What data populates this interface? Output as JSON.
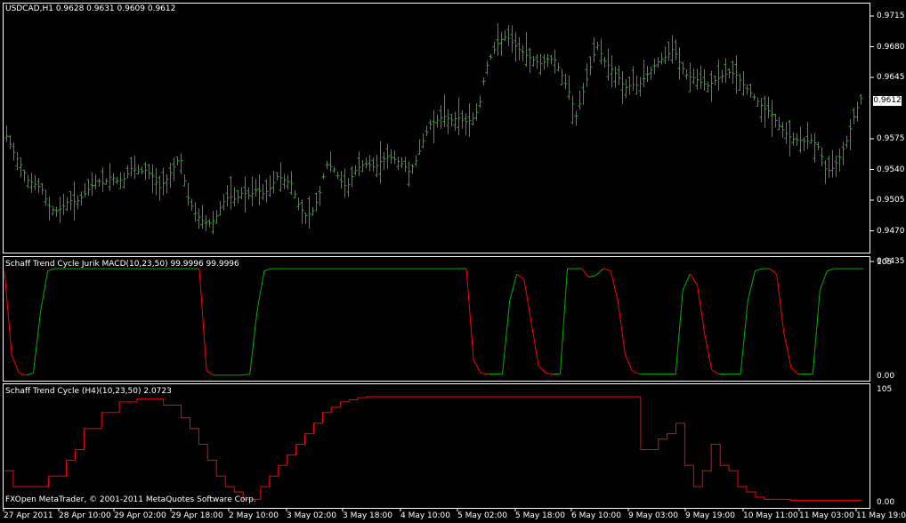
{
  "main_header": "USDCAD,H1  0.9628 0.9631 0.9609 0.9612",
  "current_price": "0.9612",
  "footer_text": "FXOpen MetaTrader, © 2001-2011 MetaQuotes Software Corp.",
  "colors": {
    "background": "#000000",
    "frame": "#ffffff",
    "bars": "#00c000",
    "up": "#00b000",
    "down": "#ff0000"
  },
  "chart_data": [
    {
      "type": "ohlc",
      "title": "USDCAD,H1",
      "ylim": [
        0.942,
        0.973
      ],
      "y_ticks": [
        "0.9715",
        "0.9680",
        "0.9645",
        "0.9612",
        "0.9575",
        "0.9540",
        "0.9505",
        "0.9470",
        "0.9435"
      ],
      "x_ticks": [
        "27 Apr 2011",
        "28 Apr 10:00",
        "29 Apr 02:00",
        "29 Apr 18:00",
        "2 May 10:00",
        "3 May 02:00",
        "3 May 18:00",
        "4 May 10:00",
        "5 May 02:00",
        "5 May 18:00",
        "6 May 10:00",
        "9 May 03:00",
        "9 May 19:00",
        "10 May 11:00",
        "11 May 03:00",
        "11 May 19:00"
      ],
      "close_path": [
        0.9565,
        0.9545,
        0.953,
        0.951,
        0.9505,
        0.95,
        0.9478,
        0.947,
        0.9475,
        0.9485,
        0.9482,
        0.949,
        0.95,
        0.951,
        0.9505,
        0.9515,
        0.9508,
        0.9512,
        0.9525,
        0.952,
        0.9522,
        0.9515,
        0.95,
        0.951,
        0.9525,
        0.954,
        0.949,
        0.947,
        0.946,
        0.9455,
        0.946,
        0.948,
        0.949,
        0.9485,
        0.9495,
        0.949,
        0.9498,
        0.9492,
        0.95,
        0.9515,
        0.951,
        0.9505,
        0.948,
        0.9465,
        0.947,
        0.949,
        0.953,
        0.9525,
        0.951,
        0.95,
        0.952,
        0.9528,
        0.953,
        0.9525,
        0.9535,
        0.954,
        0.9535,
        0.953,
        0.952,
        0.9535,
        0.956,
        0.958,
        0.9585,
        0.959,
        0.9585,
        0.9588,
        0.9583,
        0.9585,
        0.96,
        0.965,
        0.967,
        0.9685,
        0.969,
        0.968,
        0.9672,
        0.9665,
        0.966,
        0.9655,
        0.9662,
        0.966,
        0.964,
        0.962,
        0.959,
        0.962,
        0.965,
        0.968,
        0.966,
        0.965,
        0.964,
        0.9625,
        0.963,
        0.9628,
        0.964,
        0.965,
        0.966,
        0.9665,
        0.9675,
        0.9655,
        0.964,
        0.9638,
        0.9632,
        0.9628,
        0.9635,
        0.964,
        0.9645,
        0.9642,
        0.963,
        0.962,
        0.961,
        0.96,
        0.9595,
        0.958,
        0.957,
        0.9562,
        0.956,
        0.9558,
        0.956,
        0.955,
        0.952,
        0.9525,
        0.954,
        0.956,
        0.959,
        0.9612
      ]
    },
    {
      "type": "line",
      "title": "Schaff Trend Cycle Jurik MACD(10,23,50) 99.9996 99.9996",
      "ylim": [
        0,
        105
      ],
      "y_ticks": [
        "105",
        "0.00"
      ],
      "series_colors": {
        "rising": "#00b000",
        "falling": "#ff0000"
      },
      "values": [
        98,
        20,
        3,
        1,
        3,
        60,
        98,
        100,
        100,
        100,
        100,
        100,
        100,
        100,
        100,
        100,
        100,
        100,
        100,
        100,
        100,
        100,
        100,
        100,
        100,
        100,
        100,
        100,
        5,
        1,
        1,
        1,
        1,
        1,
        2,
        60,
        98,
        100,
        100,
        100,
        100,
        100,
        100,
        100,
        100,
        100,
        100,
        100,
        100,
        100,
        100,
        100,
        100,
        100,
        100,
        100,
        100,
        100,
        100,
        100,
        100,
        100,
        100,
        100,
        100,
        15,
        3,
        2,
        2,
        2,
        70,
        95,
        90,
        50,
        10,
        3,
        2,
        2,
        100,
        100,
        100,
        92,
        94,
        100,
        98,
        70,
        20,
        5,
        2,
        2,
        2,
        2,
        2,
        2,
        80,
        95,
        85,
        40,
        6,
        2,
        2,
        2,
        2,
        70,
        98,
        100,
        100,
        95,
        40,
        8,
        2,
        2,
        2,
        80,
        98,
        100,
        100,
        100,
        100,
        100
      ]
    },
    {
      "type": "line",
      "title": "Schaff Trend Cycle (H4)(10,23,50) 2.0723",
      "ylim": [
        0,
        105
      ],
      "y_ticks": [
        "105",
        "0.00"
      ],
      "color": "#ff0000",
      "steps": [
        30,
        15,
        15,
        15,
        15,
        25,
        25,
        40,
        50,
        70,
        70,
        85,
        85,
        95,
        95,
        98,
        98,
        98,
        92,
        92,
        80,
        70,
        55,
        40,
        25,
        15,
        10,
        3,
        3,
        15,
        25,
        35,
        45,
        55,
        65,
        75,
        85,
        90,
        95,
        97,
        99,
        100,
        100,
        100,
        100,
        100,
        100,
        100,
        100,
        100,
        100,
        100,
        100,
        100,
        100,
        100,
        100,
        100,
        100,
        100,
        100,
        100,
        100,
        100,
        100,
        100,
        100,
        100,
        100,
        100,
        100,
        100,
        50,
        50,
        60,
        65,
        75,
        35,
        15,
        30,
        55,
        35,
        30,
        15,
        10,
        5,
        3,
        3,
        3,
        2,
        2,
        2,
        2,
        2,
        2,
        2,
        2
      ]
    }
  ]
}
